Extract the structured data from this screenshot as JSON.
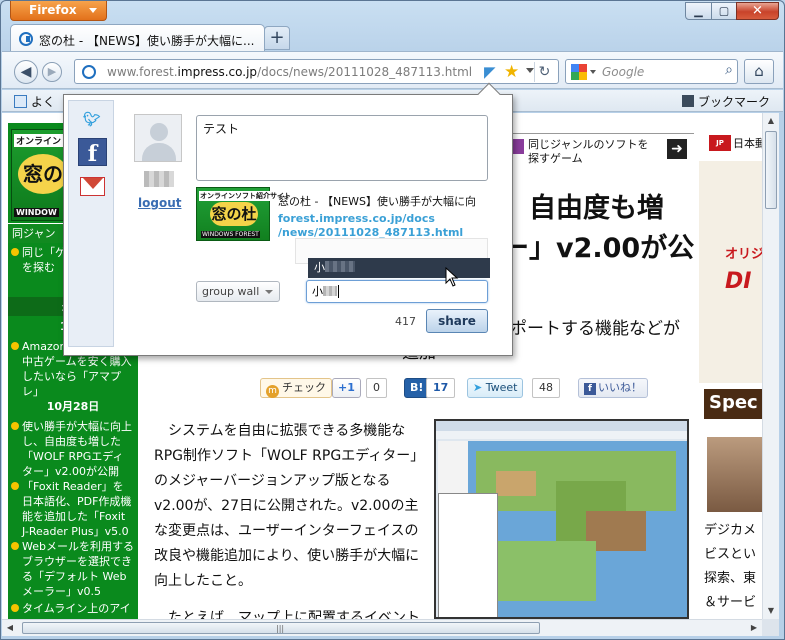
{
  "browser": {
    "app_button": "Firefox",
    "tab_title": "窓の杜 - 【NEWS】使い勝手が大幅に...",
    "url_host_prefix": "www.forest.",
    "url_host_main": "impress.co.jp",
    "url_path": "/docs/news/20111028_487113.html",
    "search_placeholder": "Google",
    "bookmark_left": "よく",
    "bookmark_right": "ブックマーク"
  },
  "page": {
    "headline_line1": "、自由度も増",
    "headline_line2": "ー」v2.00が公",
    "headline_line3": "ポートする機能などが",
    "headline_line3b": "追加",
    "same_genre": "同じジャンルのソフトを探すゲーム",
    "left": {
      "logo_top": "オンライン",
      "logo_main": "窓の",
      "logo_bottom": "WINDOW",
      "section1": "同ジャン",
      "section1_item": "同じ「ゲームのソフトを探む",
      "section2": "最新",
      "date1": "10月",
      "item_amazon": "Amazon プレイス で中古ゲームを安く購入したいなら「アマプレ」",
      "date2": "10月28日",
      "item_wolf": "使い勝手が大幅に向上し、自由度も増した「WOLF RPGエディター」v2.00が公開",
      "item_foxit": "「Foxit Reader」を日本語化、PDF作成機能を追加した「Foxit J-Reader Plus」v5.0",
      "item_webmail": "Webメールを利用するブラウザーを選択できる「デフォルト Web メーラー」v0.5",
      "item_timeline": "タイムライン上のアイ"
    },
    "share": {
      "check": "チェック",
      "plus1": "+1",
      "plus1_count": "0",
      "hatena": "B!",
      "hatena_count": "17",
      "tweet": "Tweet",
      "tweet_count": "48",
      "like": "いいね！"
    },
    "body": "システムを自由に拡張できる多機能なRPG制作ソフト「WOLF RPGエディター」のメジャーバージョンアップ版となるv2.00が、27日に公開された。v2.00の主な変更点は、ユーザーインターフェイスの改良や機能追加により、使い勝手が大幅に向上したこと。",
    "body_next": "たとえば、マップ上に配置するイベント",
    "right": {
      "jp_post": "日本郵",
      "ad_a": "オリジ",
      "ad_b": "DI",
      "special": "Spec",
      "text": "デジカメ\nビスとい\n探索、東\n＆サービ"
    }
  },
  "popup": {
    "comment": "テスト",
    "logout": "logout",
    "card_title": "窓の杜 - 【NEWS】使い勝手が大幅に向",
    "card_url": "forest.impress.co.jp/docs/news/20111028_487113.html",
    "thumb_top": "オンラインソフト紹介サイト",
    "thumb_main": "窓の杜",
    "thumb_bottom": "WINDOWS FOREST",
    "group_select": "group wall",
    "suggest_prefix": "小",
    "to_prefix": "小",
    "char_count": "417",
    "share_button": "share"
  }
}
